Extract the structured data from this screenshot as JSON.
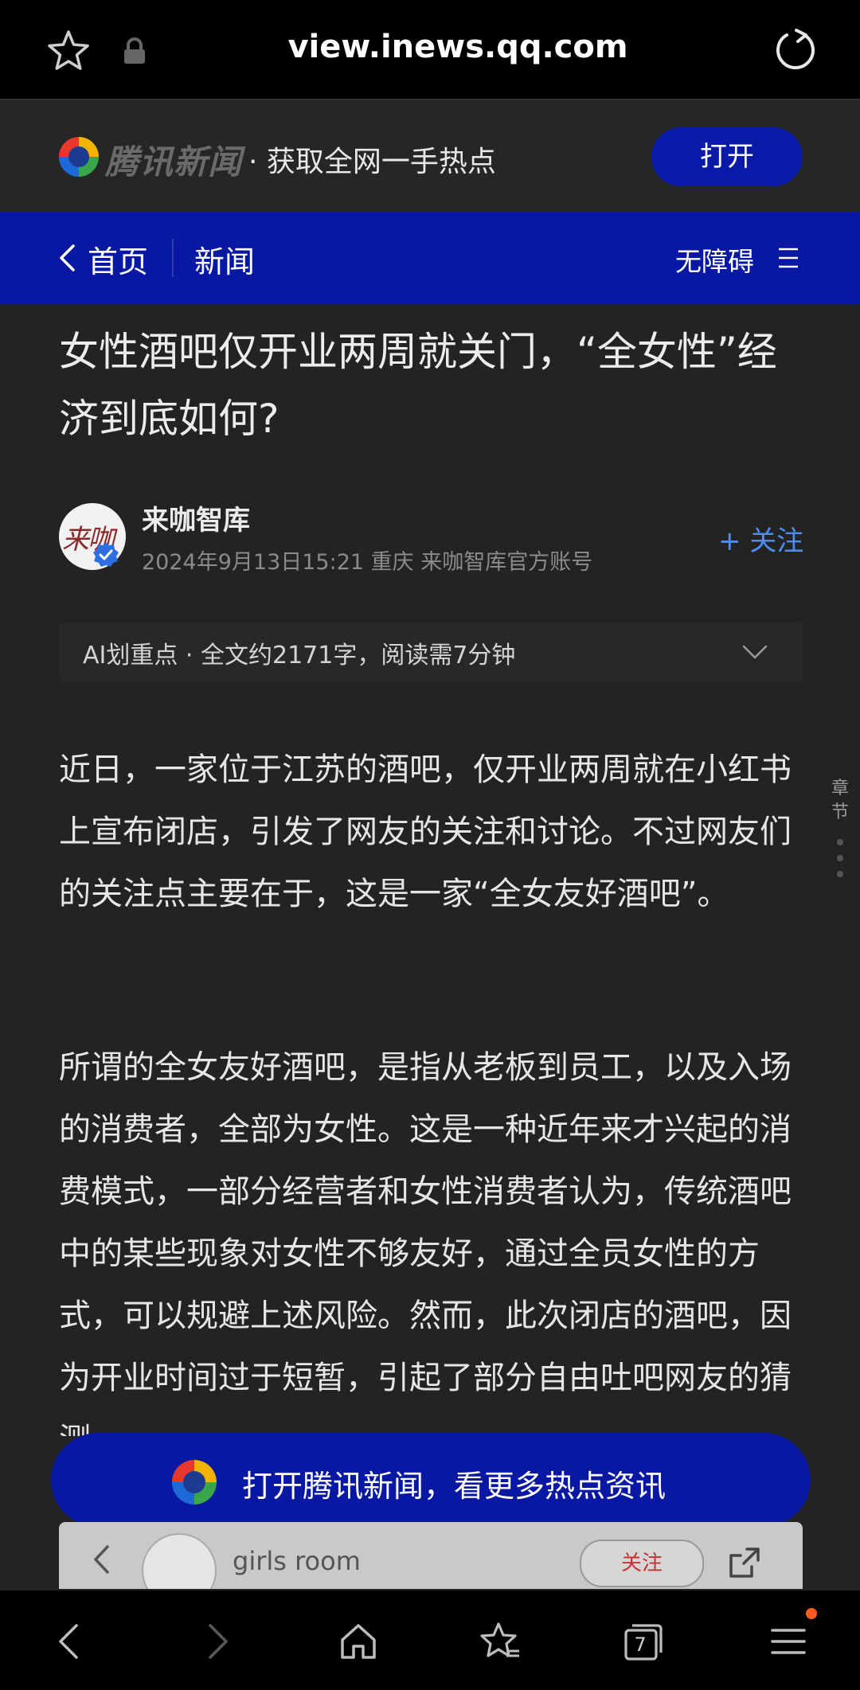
{
  "browser": {
    "url": "view.inews.qq.com",
    "tab_count": "7"
  },
  "promo": {
    "brand": "腾讯新闻",
    "slogan": "· 获取全网一手热点",
    "open_label": "打开"
  },
  "nav": {
    "home_label": "首页",
    "section_label": "新闻",
    "accessibility_label": "无障碍"
  },
  "article": {
    "title": "女性酒吧仅开业两周就关门，“全女性”经济到底如何?",
    "author": {
      "avatar_text": "来咖",
      "name": "来咖智库",
      "meta": "2024年9月13日15:21  重庆  来咖智库官方账号",
      "follow_label": "+ 关注"
    },
    "ai_summary": "AI划重点 · 全文约2171字，阅读需7分钟",
    "paragraphs": [
      "近日，一家位于江苏的酒吧，仅开业两周就在小红书上宣布闭店，引发了网友的关注和讨论。不过网友们的关注点主要在于，这是一家“全女友好酒吧”。",
      "所谓的全女友好酒吧，是指从老板到员工，以及入场的消费者，全部为女性。这是一种近年来才兴起的消费模式，一部分经营者和女性消费者认为，传统酒吧中的某些现象对女性不够友好，通过全员女性的方式，可以规避上述风险。然而，此次闭店的酒吧，因为开业时间过于短暂，引起了部分自由吐吧网友的猜测"
    ],
    "chapter_label": "章节"
  },
  "floating_cta": {
    "label": "打开腾讯新闻，看更多热点资讯"
  },
  "embedded_card": {
    "name": "girls room",
    "follow_label": "关注"
  },
  "colors": {
    "brand_blue": "#0818a3",
    "link_blue": "#4d8ef0",
    "background": "#232323"
  }
}
